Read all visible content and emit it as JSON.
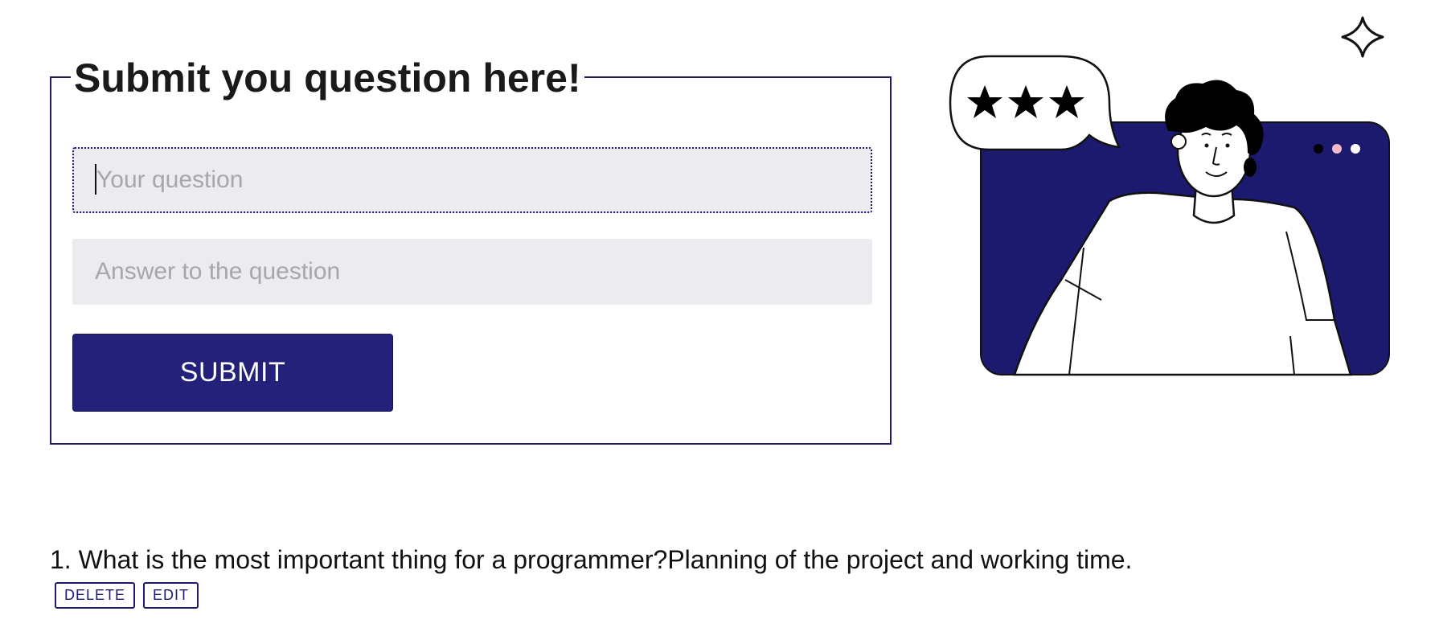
{
  "form": {
    "title": "Submit you question here!",
    "question_placeholder": "Your question",
    "question_value": "",
    "answer_placeholder": "Answer to the question",
    "answer_value": "",
    "submit_label": "SUBMIT"
  },
  "illustration": {
    "icons": [
      "sparkle-icon",
      "star-icon",
      "star-icon",
      "star-icon",
      "window-dots-icon",
      "person-illustration"
    ],
    "accent_color": "#1c1a6e",
    "dot_colors": [
      "#000000",
      "#f5b8c6",
      "#ffffff"
    ],
    "rating_stars": 3
  },
  "questions": [
    {
      "number": "1.",
      "question": "What is the most important thing for a programmer?",
      "answer": "Planning of the project and working time.",
      "text": "1. What is the most important thing for a programmer?Planning of the project and working time.",
      "delete_label": "DELETE",
      "edit_label": "EDIT"
    }
  ],
  "colors": {
    "primary": "#24217b",
    "field_bg": "#ececf0",
    "placeholder": "#a6a6ab"
  }
}
